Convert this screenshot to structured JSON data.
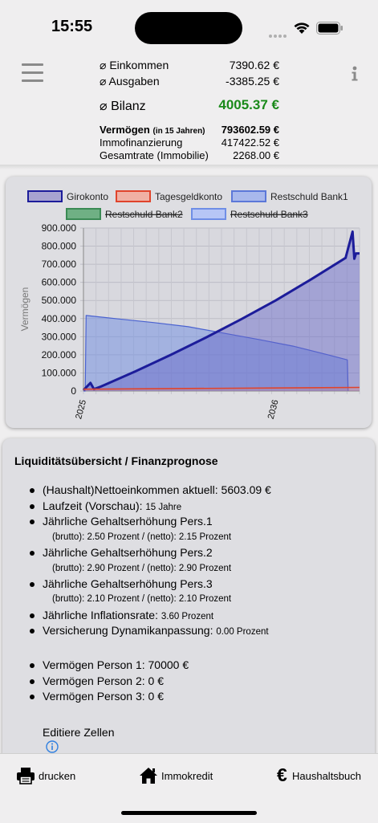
{
  "status": {
    "time": "15:55"
  },
  "header": {
    "einkommen_label": "⌀ Einkommen",
    "einkommen_value": "7390.62 €",
    "ausgaben_label": "⌀ Ausgaben",
    "ausgaben_value": "-3385.25 €",
    "bilanz_label": "⌀ Bilanz",
    "bilanz_value": "4005.37 €",
    "vermoegen_label": "Vermögen",
    "vermoegen_sub": "(in 15 Jahren)",
    "vermoegen_value": "793602.59 €",
    "immo_label": "Immofinanzierung",
    "immo_value": "417422.52 €",
    "rate_label": "Gesamtrate (Immobilie)",
    "rate_value": "2268.00 €",
    "colors": {
      "bilanz": "#1a8a1a"
    }
  },
  "chart_data": {
    "type": "area",
    "legend": [
      {
        "name": "Girokonto",
        "fill": "#a7a3d0",
        "stroke": "#1c1c9a",
        "hidden": false
      },
      {
        "name": "Tagesgeldkonto",
        "fill": "#f0b0a4",
        "stroke": "#e0442c",
        "hidden": false
      },
      {
        "name": "Restschuld Bank1",
        "fill": "#a8b8ec",
        "stroke": "#5c78d8",
        "hidden": false
      },
      {
        "name": "Restschuld Bank2",
        "fill": "#6fb084",
        "stroke": "#3a8a54",
        "hidden": true
      },
      {
        "name": "Restschuld Bank3",
        "fill": "#b7c6f6",
        "stroke": "#6f8ee6",
        "hidden": true
      }
    ],
    "ylabel": "Vermögen",
    "y_ticks": [
      "900.000",
      "800.000",
      "700.000",
      "600.000",
      "500.000",
      "400.000",
      "300.000",
      "200.000",
      "100.000",
      "0"
    ],
    "ylim": [
      0,
      900000
    ],
    "x_ticks": [
      "2025",
      "2036"
    ],
    "xlim": [
      2025.0,
      2040.8
    ],
    "series": [
      {
        "name": "Girokonto",
        "points": [
          [
            2025.0,
            5000
          ],
          [
            2025.4,
            45000
          ],
          [
            2025.6,
            10000
          ],
          [
            2026,
            25000
          ],
          [
            2028,
            110000
          ],
          [
            2030,
            200000
          ],
          [
            2032,
            295000
          ],
          [
            2034,
            395000
          ],
          [
            2036,
            500000
          ],
          [
            2038,
            615000
          ],
          [
            2040,
            735000
          ],
          [
            2040.4,
            880000
          ],
          [
            2040.5,
            730000
          ],
          [
            2040.6,
            760000
          ],
          [
            2040.8,
            760000
          ]
        ]
      },
      {
        "name": "Tagesgeldkonto",
        "points": [
          [
            2025.0,
            10000
          ],
          [
            2040.8,
            20000
          ]
        ]
      },
      {
        "name": "Restschuld Bank1",
        "points": [
          [
            2025.0,
            0
          ],
          [
            2025.1,
            0
          ],
          [
            2025.15,
            417000
          ],
          [
            2027,
            398000
          ],
          [
            2029,
            378000
          ],
          [
            2031,
            355000
          ],
          [
            2033,
            320000
          ],
          [
            2035,
            285000
          ],
          [
            2037,
            248000
          ],
          [
            2039,
            200000
          ],
          [
            2040.1,
            172000
          ],
          [
            2040.15,
            0
          ]
        ]
      }
    ]
  },
  "liquidity": {
    "title": "Liquiditätsübersicht / Finanzprognose",
    "items": [
      {
        "label": "(Haushalt)Nettoeinkommen aktuell: 5603.09 €"
      },
      {
        "label": "Laufzeit (Vorschau): ",
        "small": "15 Jahre"
      },
      {
        "label": "Jährliche Gehaltserhöhung Pers.1"
      },
      {
        "label": "Jährliche Gehaltserhöhung Pers.2"
      },
      {
        "label": "Jährliche Gehaltserhöhung Pers.3"
      },
      {
        "label": "Jährliche Inflationsrate: ",
        "small": "3.60 Prozent"
      },
      {
        "label": "Versicherung Dynamikanpassung: ",
        "small": "0.00 Prozent"
      }
    ],
    "sub1": "(brutto): 2.50 Prozent / (netto): 2.15 Prozent",
    "sub2": "(brutto): 2.90 Prozent / (netto): 2.90 Prozent",
    "sub3": "(brutto): 2.10 Prozent / (netto): 2.10 Prozent",
    "persons": [
      "Vermögen Person 1: 70000 €",
      "Vermögen Person 2: 0 €",
      "Vermögen Person 3: 0 €"
    ],
    "edit_label": "Editiere Zellen"
  },
  "tabs": {
    "print": "drucken",
    "immo": "Immokredit",
    "book": "Haushaltsbuch"
  },
  "icons": {
    "menu": "hamburger-icon",
    "info": "info-icon",
    "printer": "printer-icon",
    "home": "home-icon",
    "euro": "euro-icon"
  }
}
